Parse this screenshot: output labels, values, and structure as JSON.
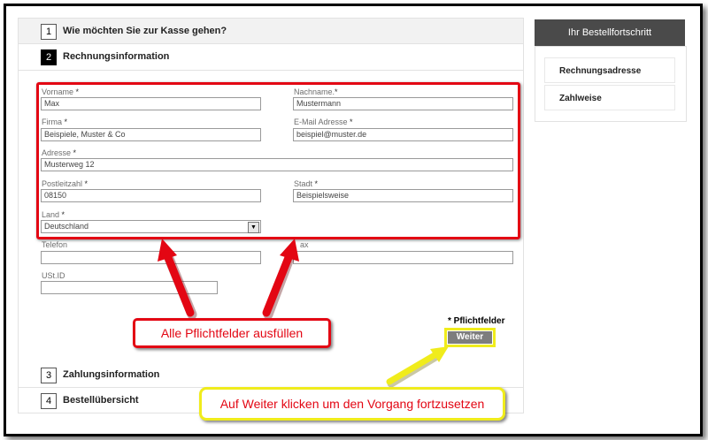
{
  "steps": [
    {
      "num": "1",
      "title": "Wie möchten Sie zur Kasse gehen?"
    },
    {
      "num": "2",
      "title": "Rechnungsinformation"
    },
    {
      "num": "3",
      "title": "Zahlungsinformation"
    },
    {
      "num": "4",
      "title": "Bestellübersicht"
    }
  ],
  "form": {
    "vorname": {
      "label": "Vorname",
      "value": "Max"
    },
    "nachname": {
      "label": "Nachname",
      "value": "Mustermann"
    },
    "firma": {
      "label": "Firma",
      "value": "Beispiele, Muster & Co"
    },
    "email": {
      "label": "E-Mail Adresse",
      "value": "beispiel@muster.de"
    },
    "adresse": {
      "label": "Adresse",
      "value": "Musterweg 12"
    },
    "plz": {
      "label": "Postleitzahl",
      "value": "08150"
    },
    "stadt": {
      "label": "Stadt",
      "value": "Beispielsweise"
    },
    "land": {
      "label": "Land",
      "value": "Deutschland"
    },
    "telefon": {
      "label": "Telefon",
      "value": ""
    },
    "fax": {
      "label": "ax",
      "value": ""
    },
    "ustid": {
      "label": "USt.ID",
      "value": ""
    },
    "required_marker": "*",
    "required_note": "* Pflichtfelder",
    "submit_label": "Weiter"
  },
  "callouts": {
    "red": "Alle Pflichtfelder ausfüllen",
    "yellow": "Auf Weiter klicken um den Vorgang fortzusetzen"
  },
  "sidebar": {
    "title": "Ihr Bestellfortschritt",
    "items": [
      "Rechnungsadresse",
      "Zahlweise"
    ]
  },
  "colors": {
    "highlight_red": "#e30613",
    "highlight_yellow": "#f0ec1c",
    "button_gray": "#7d7d7d",
    "sidebar_header": "#4a4a4a"
  }
}
